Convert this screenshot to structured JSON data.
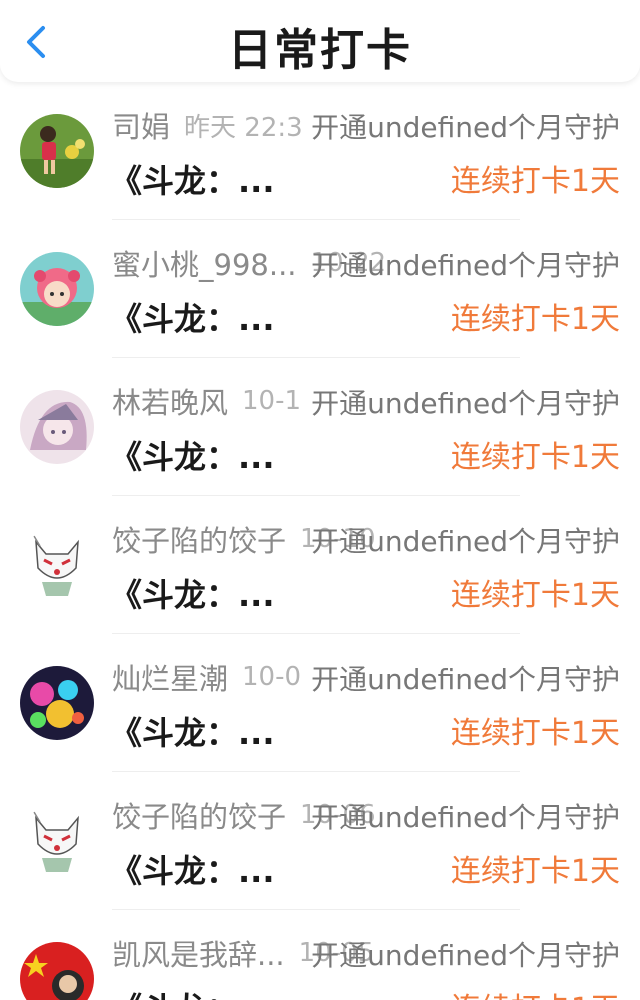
{
  "header": {
    "title": "日常打卡",
    "back_icon": "chevron-left-icon",
    "accent": "#2b8ef0"
  },
  "colors": {
    "streak": "#f07a3a",
    "name": "#8a8a8a",
    "time": "#b3b3b3"
  },
  "items": [
    {
      "name": "司娟",
      "time": "昨天 22:3",
      "guard": "开通undefined个月守护",
      "title": "《斗龙：...",
      "streak": "连续打卡1天",
      "avatar": "child-photo-avatar"
    },
    {
      "name": "蜜小桃_998...",
      "time": "10-22",
      "guard": "开通undefined个月守护",
      "title": "《斗龙：...",
      "streak": "连续打卡1天",
      "avatar": "anime-girl-avatar"
    },
    {
      "name": "林若晚风",
      "time": "10-1",
      "guard": "开通undefined个月守护",
      "title": "《斗龙：...",
      "streak": "连续打卡1天",
      "avatar": "sketch-girl-avatar"
    },
    {
      "name": "饺子陷的饺子",
      "time": "10-10",
      "guard": "开通undefined个月守护",
      "title": "《斗龙：...",
      "streak": "连续打卡1天",
      "avatar": "fox-mask-avatar"
    },
    {
      "name": "灿烂星潮",
      "time": "10-0",
      "guard": "开通undefined个月守护",
      "title": "《斗龙：...",
      "streak": "连续打卡1天",
      "avatar": "colorful-game-avatar"
    },
    {
      "name": "饺子陷的饺子",
      "time": "10-06",
      "guard": "开通undefined个月守护",
      "title": "《斗龙：...",
      "streak": "连续打卡1天",
      "avatar": "fox-mask-avatar"
    },
    {
      "name": "凯风是我辞...",
      "time": "10-05",
      "guard": "开通undefined个月守护",
      "title": "《斗龙：...",
      "streak": "连续打卡1天",
      "avatar": "flag-avatar"
    }
  ]
}
